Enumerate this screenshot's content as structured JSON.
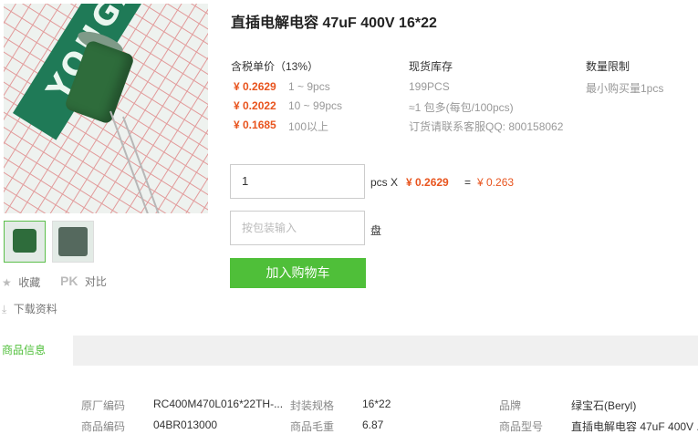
{
  "product": {
    "title": "直插电解电容 47uF 400V 16*22"
  },
  "image_watermark": "YOUGANW.COM",
  "actions": {
    "favorite": "收藏",
    "compare_badge": "PK",
    "compare": "对比",
    "download": "下载资料"
  },
  "pricing": {
    "header": "含税单价（13%）",
    "tiers": [
      {
        "price": "¥ 0.2629",
        "range": "1 ~ 9pcs"
      },
      {
        "price": "¥ 0.2022",
        "range": "10 ~ 99pcs"
      },
      {
        "price": "¥ 0.1685",
        "range": "100以上"
      }
    ]
  },
  "stock": {
    "header": "现货库存",
    "qty": "199PCS",
    "pack": "≈1 包多(每包/100pcs)",
    "contact": "订货请联系客服QQ: 800158062"
  },
  "limit": {
    "header": "数量限制",
    "min": "最小购买量1pcs"
  },
  "order": {
    "qty_value": "1",
    "unit": "pcs X",
    "unit_price": "¥ 0.2629",
    "equals": "=",
    "total": "¥ 0.263",
    "pack_placeholder": "按包装输入",
    "pack_unit": "盘",
    "add_to_cart": "加入购物车"
  },
  "tabs": {
    "active": "商品信息"
  },
  "specs": {
    "row1": [
      {
        "label": "原厂编码",
        "value": "RC400M470L016*22TH-..."
      },
      {
        "label": "封装规格",
        "value": "16*22"
      },
      {
        "label": "品牌",
        "value": "绿宝石(Beryl)"
      }
    ],
    "row2": [
      {
        "label": "商品编码",
        "value": "04BR013000"
      },
      {
        "label": "商品毛重",
        "value": "6.87"
      },
      {
        "label": "商品型号",
        "value": "直插电解电容 47uF 400V ..."
      }
    ]
  },
  "colors": {
    "accent": "#4fbf39",
    "price": "#e8541e"
  }
}
